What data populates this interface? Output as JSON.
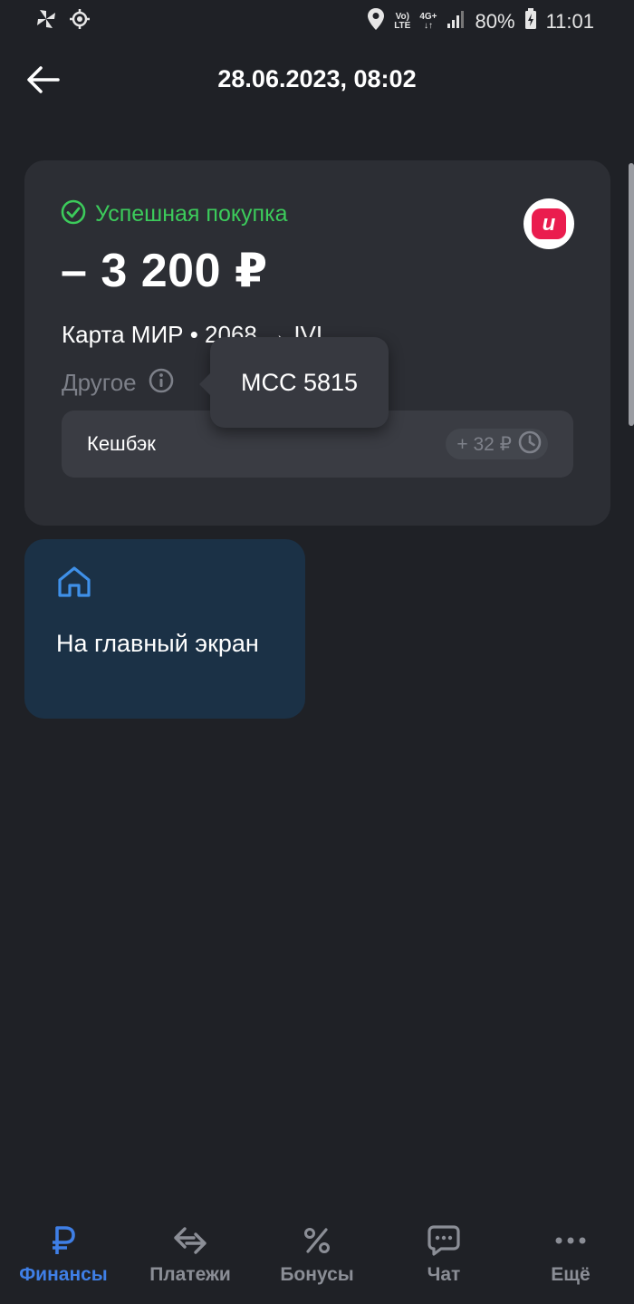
{
  "status_bar": {
    "network_top": "Vo)",
    "network_bottom": "LTE",
    "signal_top": "4G+",
    "signal_bottom": "↓↑",
    "battery": "80%",
    "time": "11:01"
  },
  "header": {
    "title": "28.06.2023, 08:02"
  },
  "transaction": {
    "status": "Успешная покупка",
    "amount": "– 3 200 ₽",
    "merchant_logo_letter": "и",
    "card_info": "Карта МИР • 2068 → IVI",
    "category": "Другое",
    "cashback_label": "Кешбэк",
    "cashback_value": "+ 32 ₽"
  },
  "tooltip": {
    "text": "MCC 5815"
  },
  "home_tile": {
    "label": "На главный экран"
  },
  "nav": [
    {
      "label": "Финансы",
      "icon": "ruble-icon",
      "active": true
    },
    {
      "label": "Платежи",
      "icon": "transfer-arrows-icon",
      "active": false
    },
    {
      "label": "Бонусы",
      "icon": "percent-icon",
      "active": false
    },
    {
      "label": "Чат",
      "icon": "chat-icon",
      "active": false
    },
    {
      "label": "Ещё",
      "icon": "more-dots-icon",
      "active": false
    }
  ],
  "colors": {
    "background": "#1f2126",
    "card": "#2c2e34",
    "success": "#3ccb5b",
    "accent": "#3f7fe6",
    "home_tile": "#1b3146",
    "merchant": "#ea1c4e"
  }
}
